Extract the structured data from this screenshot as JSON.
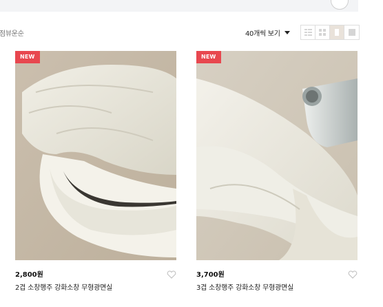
{
  "toolbar": {
    "sort_label": "점뷰운순",
    "per_page_label": "40개씩 보기",
    "view_options": [
      "list-view-icon",
      "grid-2-icon",
      "grid-1-icon",
      "grid-4-icon"
    ],
    "active_view": "grid-1-icon"
  },
  "colors": {
    "badge": "#e8474f",
    "active_view_bg": "#e9e2da",
    "top_bar": "#f3f4f6"
  },
  "products": [
    {
      "badge": "NEW",
      "price": "2,800원",
      "title": "2겹 소창행주 강화소창 무형광면실",
      "liked": false
    },
    {
      "badge": "NEW",
      "price": "3,700원",
      "title": "3겹 소창행주 강화소창 무형광면실",
      "liked": false
    }
  ]
}
